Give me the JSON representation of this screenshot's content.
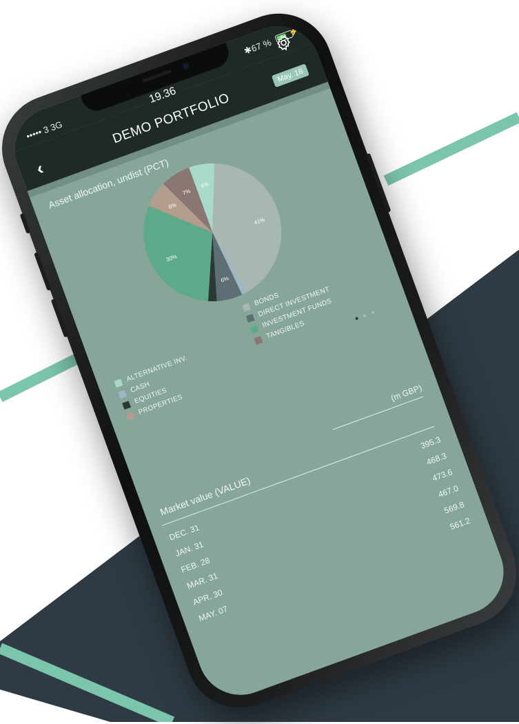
{
  "status_bar": {
    "carrier": "••••• 3  3G",
    "time": "19.36",
    "battery_percent": "67 %",
    "battery_level": 0.67
  },
  "header": {
    "title": "DEMO PORTFOLIO",
    "back_icon": "chevron-left-icon",
    "settings_icon": "gear-icon",
    "date_badge": "May. 18"
  },
  "allocation": {
    "title": "Asset allocation, undist (PCT)",
    "legend_left": [
      {
        "label": "ALTERNATIVE INV.",
        "color": "#a9d9c9"
      },
      {
        "label": "CASH",
        "color": "#9db7c7"
      },
      {
        "label": "EQUITIES",
        "color": "#2b3834"
      },
      {
        "label": "PROPERTIES",
        "color": "#b59d8e"
      }
    ],
    "legend_right": [
      {
        "label": "BONDS",
        "color": "#a9b7b1"
      },
      {
        "label": "DIRECT INVESTMENT",
        "color": "#5e6e75"
      },
      {
        "label": "INVESTMENT FUNDS",
        "color": "#5daa8a"
      },
      {
        "label": "TANGIBLES",
        "color": "#8a7672"
      }
    ],
    "pager_dots": 3,
    "pager_active": 0
  },
  "chart_data": {
    "type": "pie",
    "title": "Asset allocation, undist (PCT)",
    "slices": [
      {
        "label": "ALTERNATIVE INV.",
        "value": 6,
        "text": "6%",
        "color": "#a9d9c9"
      },
      {
        "label": "BONDS",
        "value": 41,
        "text": "41%",
        "color": "#a9b7b1"
      },
      {
        "label": "CASH",
        "value": 1,
        "text": "",
        "color": "#9db7c7"
      },
      {
        "label": "DIRECT INVESTMENT",
        "value": 6,
        "text": "6%",
        "color": "#5e6e75"
      },
      {
        "label": "EQUITIES",
        "value": 2,
        "text": "",
        "color": "#2b3834"
      },
      {
        "label": "INVESTMENT FUNDS",
        "value": 30,
        "text": "30%",
        "color": "#5daa8a"
      },
      {
        "label": "PROPERTIES",
        "value": 6,
        "text": "6%",
        "color": "#b59d8e"
      },
      {
        "label": "TANGIBLES",
        "value": 7,
        "text": "7%",
        "color": "#8a7672"
      }
    ]
  },
  "market_value": {
    "title": "Market value (VALUE)",
    "unit": "(m GBP)",
    "rows": [
      {
        "date": "DEC. 31",
        "value": "395.3"
      },
      {
        "date": "JAN. 31",
        "value": "468.3"
      },
      {
        "date": "FEB. 28",
        "value": "473.6"
      },
      {
        "date": "MAR. 31",
        "value": "467.0"
      },
      {
        "date": "APR. 30",
        "value": "569.8"
      },
      {
        "date": "MAY. 07",
        "value": "561.2"
      }
    ]
  },
  "colors": {
    "screen_bg": "#86a69a",
    "header_bg": "#1f2a26",
    "accent_teal": "#7cc5ad",
    "backdrop_dark": "#2f3b44"
  }
}
